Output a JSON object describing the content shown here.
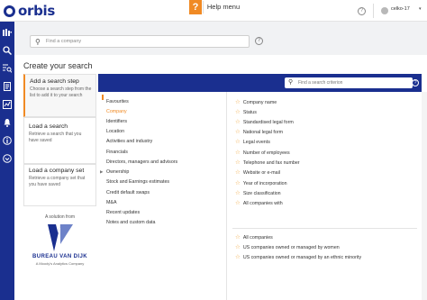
{
  "app": {
    "logo": "orbis"
  },
  "topbar": {
    "help_icon": "?",
    "help_menu": "Help menu",
    "user_name": "celko-17",
    "help_circle": "?"
  },
  "search": {
    "placeholder": "Find a company",
    "help": "?"
  },
  "page": {
    "title": "Create your search"
  },
  "steps": [
    {
      "title": "Add a search step",
      "desc": "Choose a search step from the list to add it to your search"
    },
    {
      "title": "Load a search",
      "desc": "Retrieve a search that you have saved"
    },
    {
      "title": "Load a company set",
      "desc": "Retrieve a company set that you have saved"
    }
  ],
  "brand": {
    "solution_from": "A solution from",
    "name": "BUREAU VAN DIJK",
    "sub": "A Moody's Analytics Company"
  },
  "criterion_search": {
    "placeholder": "Find a search criterion",
    "help": "?"
  },
  "categories": [
    "Favourites",
    "Company",
    "Identifiers",
    "Location",
    "Activities and industry",
    "Financials",
    "Directors, managers and advisors",
    "Ownership",
    "Stock and Earnings estimates",
    "Credit default swaps",
    "M&A",
    "Recent updates",
    "Notes and custom data"
  ],
  "criteria": [
    "Company name",
    "Status",
    "Standardised legal form",
    "National legal form",
    "Legal events",
    "Number of employees",
    "Telephone and fax number",
    "Website or e-mail",
    "Year of incorporation",
    "Size classification",
    "All companies with"
  ],
  "criteria_groups": [
    "All companies",
    "US companies owned or managed by women",
    "US companies owned or managed by an ethnic minority"
  ],
  "colors": {
    "brand": "#1a2f8f",
    "accent": "#f08a24"
  }
}
